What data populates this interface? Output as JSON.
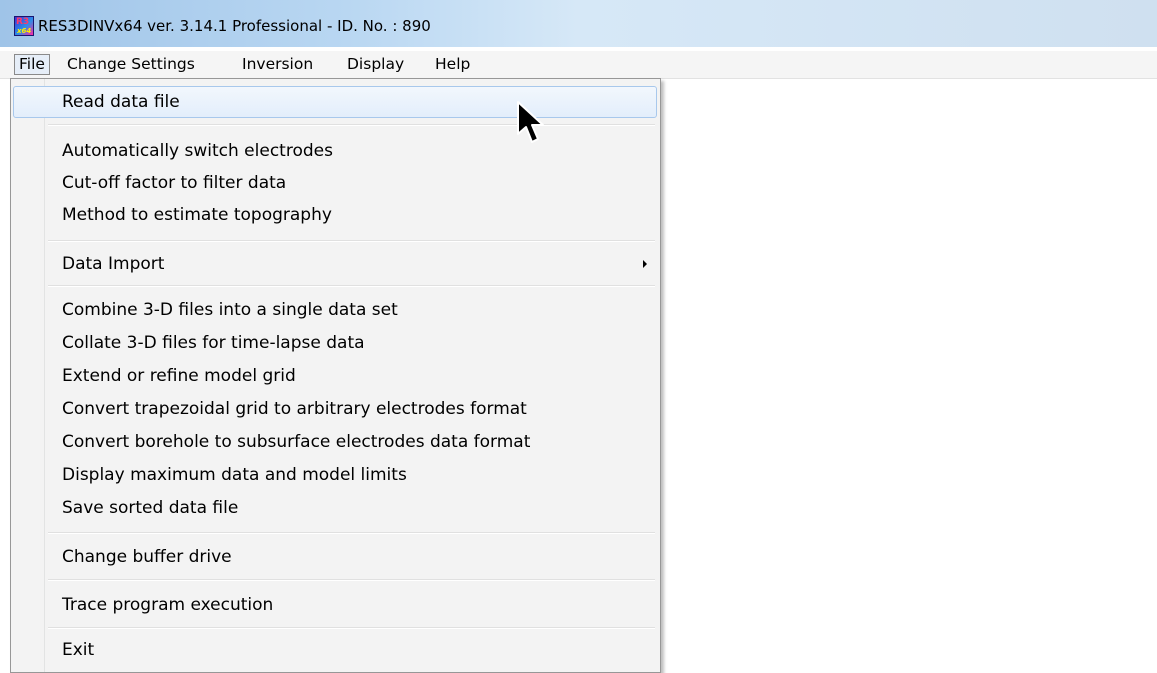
{
  "window": {
    "title": "RES3DINVx64 ver. 3.14.1 Professional - ID. No. : 890",
    "icon": "res3dinv-app-icon",
    "icon_text_top": "R3",
    "icon_text_bottom": "x64"
  },
  "menubar": {
    "items": [
      "File",
      "Change Settings",
      "Inversion",
      "Display",
      "Help"
    ],
    "active": "File"
  },
  "file_menu": {
    "groups": [
      [
        "Read data file"
      ],
      [
        "Automatically switch electrodes",
        "Cut-off factor to filter data",
        "Method to estimate topography"
      ],
      [
        "Data Import"
      ],
      [
        "Combine 3-D files into a single data set",
        "Collate 3-D files for time-lapse data",
        "Extend or refine model grid",
        "Convert trapezoidal grid to arbitrary electrodes format",
        "Convert borehole to subsurface electrodes data format",
        "Display maximum data and model limits",
        "Save sorted data file"
      ],
      [
        "Change buffer drive"
      ],
      [
        "Trace program execution"
      ],
      [
        "Exit"
      ]
    ],
    "highlighted": "Read data file",
    "has_submenu": "Data Import"
  },
  "colors": {
    "titlebar": "#b9d7f2",
    "menu_background": "#f3f3f3",
    "highlight": "#e3eefb",
    "highlight_border": "#a8c8ec"
  }
}
